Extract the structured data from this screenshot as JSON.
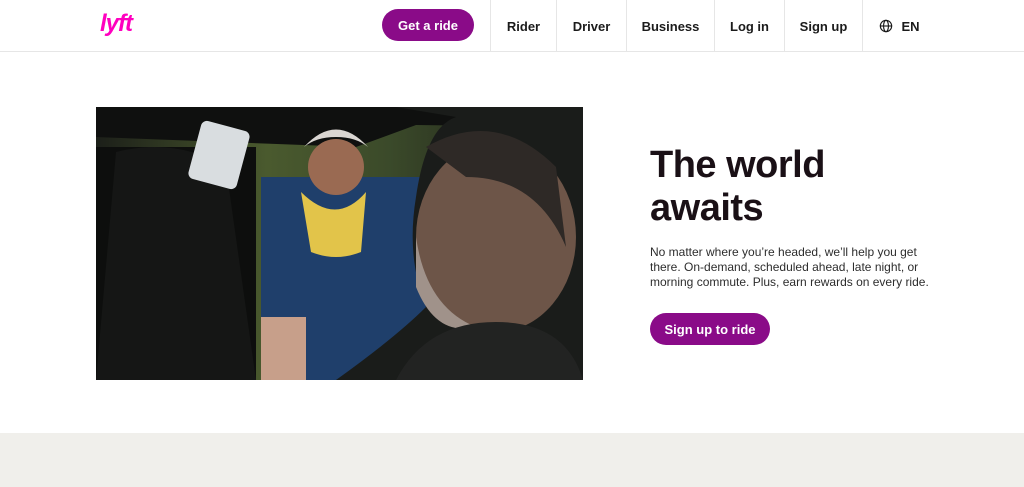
{
  "header": {
    "logo_text": "lyft",
    "cta_label": "Get a ride",
    "nav": [
      {
        "label": "Rider"
      },
      {
        "label": "Driver"
      },
      {
        "label": "Business"
      },
      {
        "label": "Log in"
      },
      {
        "label": "Sign up"
      }
    ],
    "language": {
      "label": "EN",
      "icon": "globe-icon"
    }
  },
  "hero": {
    "title_line1": "The world",
    "title_line2": "awaits",
    "description": "No matter where you’re headed, we’ll help you get there. On-demand, scheduled ahead, late night, or morning commute. Plus, earn rewards on every ride.",
    "cta_label": "Sign up to ride"
  },
  "colors": {
    "brand_pink": "#ff00bf",
    "primary_purple": "#8a0b88",
    "footer_band": "#f0efeb"
  }
}
